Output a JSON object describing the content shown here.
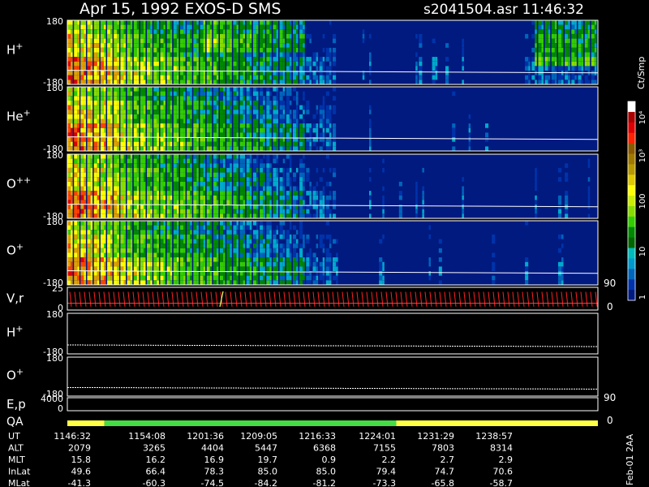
{
  "header": {
    "title": "Apr 15, 1992   EXOS-D SMS",
    "file_time": "s2041504.asr  11:46:32"
  },
  "colorbar": {
    "label": "Ct/Smp",
    "tick_labels": [
      "10⁴",
      "10³",
      "100",
      "10",
      "1"
    ],
    "tick_values": [
      10000,
      1000,
      100,
      10,
      1
    ],
    "colors": [
      "#ffffff",
      "#aa0000",
      "#dd0000",
      "#ff2200",
      "#8b5a00",
      "#a07800",
      "#b89800",
      "#e0c800",
      "#ffff00",
      "#ccee00",
      "#88dd00",
      "#33cc00",
      "#008800",
      "#006600",
      "#00bbbb",
      "#0099cc",
      "#0066bb",
      "#0033aa",
      "#001a80"
    ]
  },
  "right_axis": {
    "upper": "90",
    "lower": "0"
  },
  "footer": {
    "stamp": "Feb-01 2AA",
    "rows": [
      {
        "label": "UT",
        "values": [
          "1146:32",
          "1154:08",
          "1201:36",
          "1209:05",
          "1216:33",
          "1224:01",
          "1231:29",
          "1238:57"
        ]
      },
      {
        "label": "ALT",
        "values": [
          "2079",
          "3265",
          "4404",
          "5447",
          "6368",
          "7155",
          "7803",
          "8314"
        ]
      },
      {
        "label": "MLT",
        "values": [
          "15.8",
          "16.2",
          "16.9",
          "19.7",
          "0.9",
          "2.2",
          "2.7",
          "2.9"
        ]
      },
      {
        "label": "InLat",
        "values": [
          "49.6",
          "66.4",
          "78.3",
          "85.0",
          "85.0",
          "79.4",
          "74.7",
          "70.6"
        ]
      },
      {
        "label": "MLat",
        "values": [
          "-41.3",
          "-60.3",
          "-74.5",
          "-84.2",
          "-81.2",
          "-73.3",
          "-65.8",
          "-58.7"
        ]
      }
    ]
  },
  "chart_data": {
    "type": "heatmap",
    "x_axis": {
      "label": "UT",
      "ticks": [
        "1146:32",
        "1154:08",
        "1201:36",
        "1209:05",
        "1216:33",
        "1224:01",
        "1231:29",
        "1238:57"
      ]
    },
    "panels": [
      {
        "name": "H+",
        "label_base": "H",
        "label_sup": "+",
        "y_top": "180",
        "y_bottom": "-180",
        "kind": "spectrogram",
        "top_activity": true
      },
      {
        "name": "He+",
        "label_base": "He",
        "label_sup": "+",
        "y_top": "180",
        "y_bottom": "-180",
        "kind": "spectrogram",
        "top_activity": false
      },
      {
        "name": "O++",
        "label_base": "O",
        "label_sup": "++",
        "y_top": "180",
        "y_bottom": "-180",
        "kind": "spectrogram",
        "top_activity": false
      },
      {
        "name": "O+",
        "label_base": "O",
        "label_sup": "+",
        "y_top": "180",
        "y_bottom": "-180",
        "kind": "spectrogram",
        "top_activity": false
      },
      {
        "name": "V,r",
        "label_base": "V,r",
        "label_sup": "",
        "y_top": "25",
        "y_bottom": "0",
        "kind": "velocity"
      },
      {
        "name": "H+ (angle)",
        "label_base": "H",
        "label_sup": "+",
        "y_top": "180",
        "y_bottom": "-180",
        "kind": "trace"
      },
      {
        "name": "O+ (angle)",
        "label_base": "O",
        "label_sup": "+",
        "y_top": "180",
        "y_bottom": "-180",
        "kind": "trace"
      },
      {
        "name": "E,p",
        "label_base": "E,p",
        "label_sup": "",
        "y_top": "4000",
        "y_bottom": "0",
        "kind": "ep"
      }
    ],
    "qa": {
      "label": "QA",
      "segments": [
        {
          "from": 0.0,
          "to": 0.07,
          "color": "#ffff44"
        },
        {
          "from": 0.07,
          "to": 0.62,
          "color": "#44dd44"
        },
        {
          "from": 0.62,
          "to": 1.0,
          "color": "#ffff44"
        }
      ]
    }
  }
}
